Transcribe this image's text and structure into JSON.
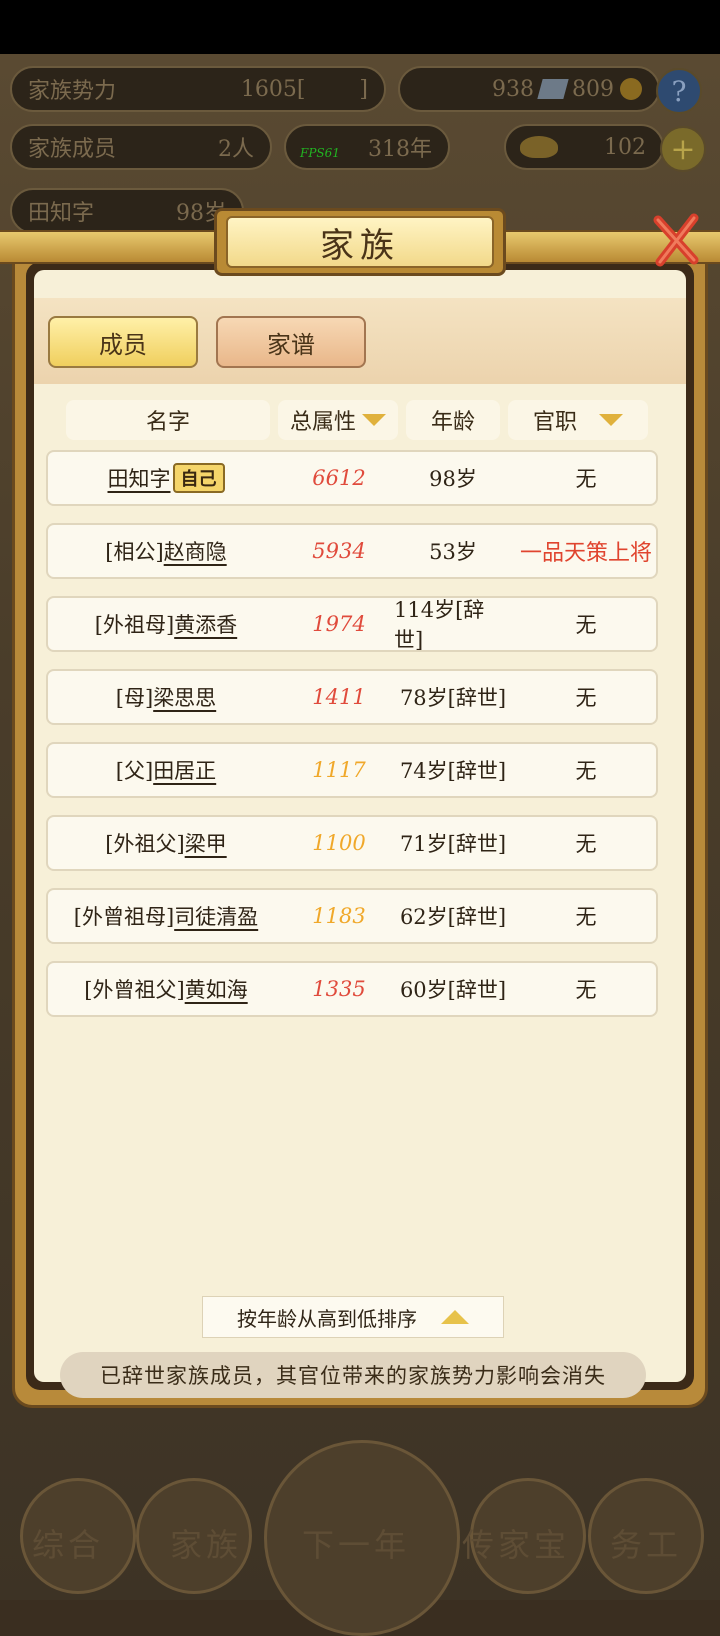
{
  "hud": {
    "clan_power_label": "家族势力",
    "clan_power_value": "1605[",
    "clan_power_suffix": "]",
    "silver": "938",
    "copper": "809",
    "members_label": "家族成员",
    "members_value": "2人",
    "year_value": "318年",
    "gold": "102",
    "fps": "FPS61",
    "player_name": "田知字",
    "player_age": "98岁",
    "help_icon": "question-icon",
    "add_icon": "plus-icon"
  },
  "dialog": {
    "title": "家族",
    "tabs": [
      "成员",
      "家谱"
    ],
    "columns": {
      "name": "名字",
      "attr": "总属性",
      "age": "年龄",
      "office": "官职"
    },
    "rows": [
      {
        "name_prefix": "",
        "name": "田知字",
        "self_tag": "自己",
        "attr": "6612",
        "age": "98岁",
        "office": "无"
      },
      {
        "name_prefix": "[相公]",
        "name": "赵商隐",
        "attr": "5934",
        "age": "53岁",
        "office": "一品天策上将"
      },
      {
        "name_prefix": "[外祖母]",
        "name": "黄添香",
        "attr": "1974",
        "age": "114岁[辞世]",
        "office": "无"
      },
      {
        "name_prefix": "[母]",
        "name": "梁思思",
        "attr": "1411",
        "age": "78岁[辞世]",
        "office": "无"
      },
      {
        "name_prefix": "[父]",
        "name": "田居正",
        "attr": "1117",
        "age": "74岁[辞世]",
        "office": "无"
      },
      {
        "name_prefix": "[外祖父]",
        "name": "梁甲",
        "attr": "1100",
        "age": "71岁[辞世]",
        "office": "无"
      },
      {
        "name_prefix": "[外曾祖母]",
        "name": "司徒清盈",
        "attr": "1183",
        "age": "62岁[辞世]",
        "office": "无"
      },
      {
        "name_prefix": "[外曾祖父]",
        "name": "黄如海",
        "attr": "1335",
        "age": "60岁[辞世]",
        "office": "无"
      }
    ],
    "sort_label": "按年龄从高到低排序",
    "notice": "已辞世家族成员，其官位带来的家族势力影响会消失"
  },
  "bottom_nav": [
    "综合",
    "家族",
    "下一年",
    "传家宝",
    "务工"
  ],
  "colors": {
    "attr_red": "#e04b3c",
    "attr_orange": "#f0a82a",
    "office_red": "#e0442e"
  }
}
